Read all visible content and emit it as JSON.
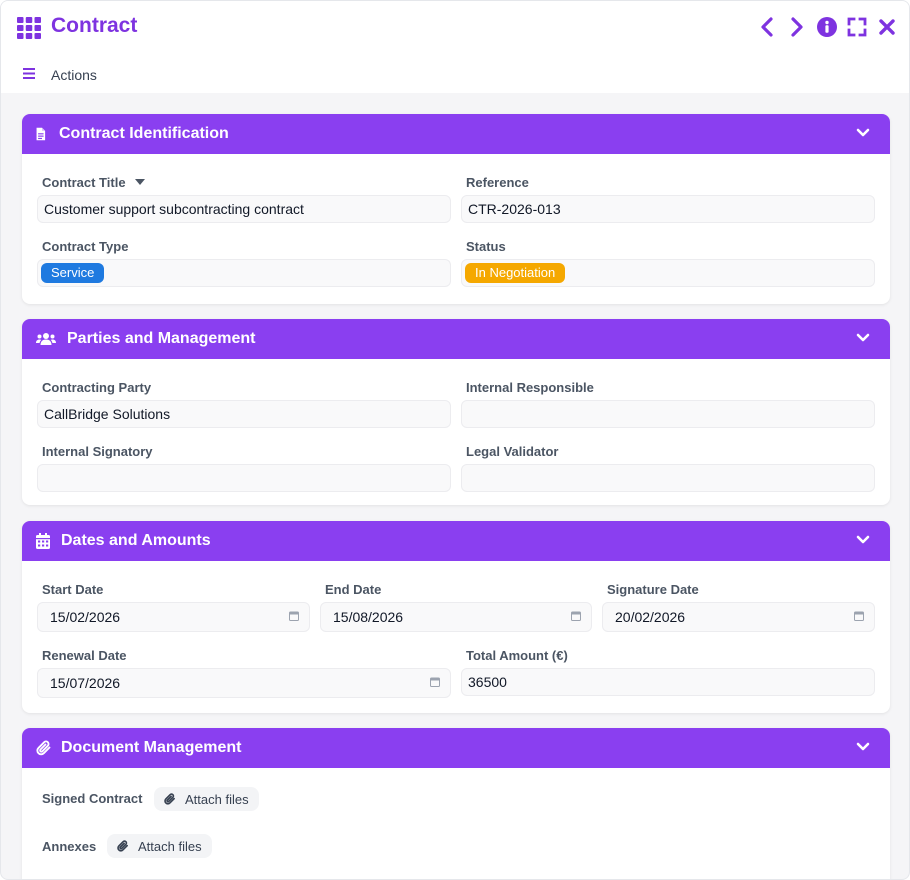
{
  "window": {
    "title": "Contract",
    "actions_label": "Actions"
  },
  "colors": {
    "accent": "#8a3ff0",
    "title": "#7e33e0",
    "badge_service": "#1f7ae0",
    "badge_status": "#f5a800"
  },
  "sections": {
    "identification": {
      "title": "Contract Identification",
      "contract_title_label": "Contract Title",
      "contract_title_value": "Customer support subcontracting contract",
      "reference_label": "Reference",
      "reference_value": "CTR-2026-013",
      "contract_type_label": "Contract Type",
      "contract_type_value": "Service",
      "status_label": "Status",
      "status_value": "In Negotiation"
    },
    "parties": {
      "title": "Parties and Management",
      "contracting_party_label": "Contracting Party",
      "contracting_party_value": "CallBridge Solutions",
      "internal_responsible_label": "Internal Responsible",
      "internal_responsible_value": "",
      "internal_signatory_label": "Internal Signatory",
      "internal_signatory_value": "",
      "legal_validator_label": "Legal Validator",
      "legal_validator_value": ""
    },
    "dates": {
      "title": "Dates and Amounts",
      "start_date_label": "Start Date",
      "start_date_value": "15/02/2026",
      "end_date_label": "End Date",
      "end_date_value": "15/08/2026",
      "signature_date_label": "Signature Date",
      "signature_date_value": "20/02/2026",
      "renewal_date_label": "Renewal Date",
      "renewal_date_value": "15/07/2026",
      "total_amount_label": "Total Amount (€)",
      "total_amount_value": "36500"
    },
    "documents": {
      "title": "Document Management",
      "signed_contract_label": "Signed Contract",
      "annexes_label": "Annexes",
      "attach_label": "Attach files"
    }
  }
}
